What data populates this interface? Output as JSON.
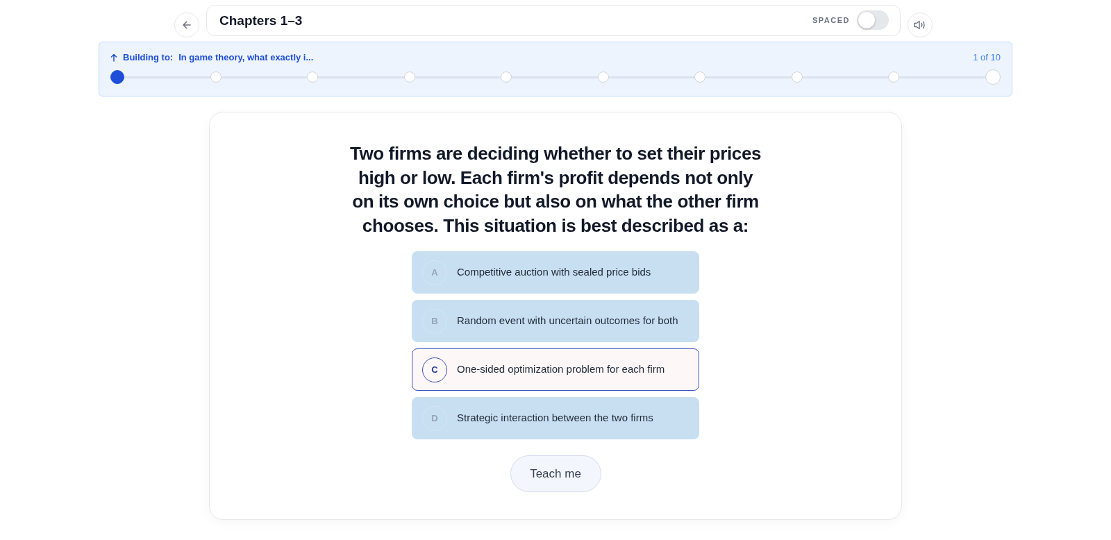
{
  "header": {
    "title": "Chapters 1–3",
    "spaced_label": "SPACED",
    "spaced_on": false
  },
  "progress": {
    "label": "Building to:",
    "goal": "In game theory, what exactly i...",
    "count": "1 of 10",
    "steps": [
      {
        "current": true
      },
      {
        "current": false
      },
      {
        "current": false
      },
      {
        "current": false
      },
      {
        "current": false
      },
      {
        "current": false
      },
      {
        "current": false
      },
      {
        "current": false
      },
      {
        "current": false
      },
      {
        "current": false
      }
    ]
  },
  "question": "Two firms are deciding whether to set their prices high or low. Each firm's profit depends not only on its own choice but also on what the other firm chooses. This situation is best described as a:",
  "options": [
    {
      "letter": "A",
      "text": "Competitive auction with sealed price bids",
      "selected": false
    },
    {
      "letter": "B",
      "text": "Random event with uncertain outcomes for both",
      "selected": false
    },
    {
      "letter": "C",
      "text": "One-sided optimization problem for each firm",
      "selected": true
    },
    {
      "letter": "D",
      "text": "Strategic interaction between the two firms",
      "selected": false
    }
  ],
  "teach_button": "Teach me"
}
